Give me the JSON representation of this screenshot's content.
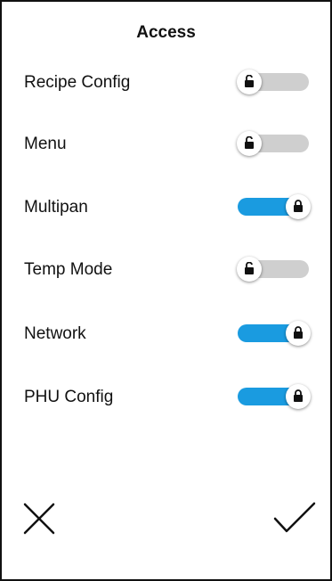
{
  "header": {
    "title": "Access"
  },
  "settings": [
    {
      "label": "Recipe Config",
      "locked": false
    },
    {
      "label": "Menu",
      "locked": false
    },
    {
      "label": "Multipan",
      "locked": true
    },
    {
      "label": "Temp Mode",
      "locked": false
    },
    {
      "label": "Network",
      "locked": true
    },
    {
      "label": "PHU Config",
      "locked": true
    }
  ],
  "colors": {
    "toggle_on": "#1a9be0",
    "toggle_off": "#cfcfcf",
    "text": "#111111",
    "border": "#111111"
  },
  "icons": {
    "unlocked": "unlocked-padlock-icon",
    "locked": "locked-padlock-icon",
    "cancel": "close-icon",
    "confirm": "checkmark-icon"
  }
}
